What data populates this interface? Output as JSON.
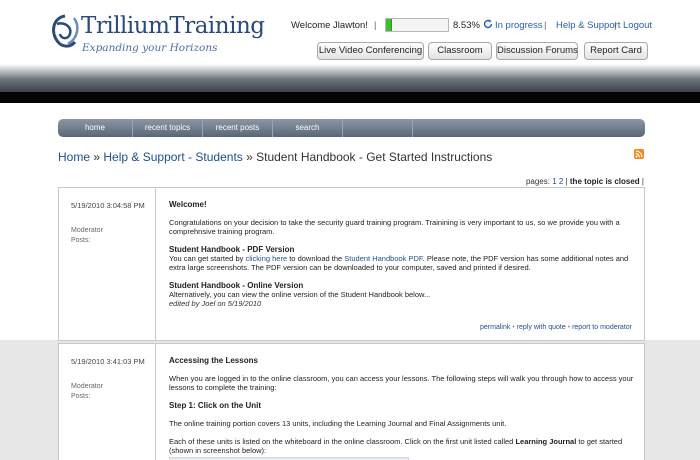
{
  "header": {
    "logo_title": "TrilliumTraining",
    "logo_tagline": "Expanding your Horizons",
    "welcome": "Welcome Jlawton!",
    "progress_percent": 8.53,
    "progress_text": "8.53%",
    "status": "In progress",
    "help_link": "Help & Support",
    "logout_link": "Logout",
    "buttons": [
      "Live Video Conferencing",
      "Classroom",
      "Discussion Forums",
      "Report Card"
    ]
  },
  "nav": {
    "items": [
      "home",
      "recent topics",
      "recent posts",
      "search"
    ]
  },
  "breadcrumb": {
    "home": "Home",
    "sep1": " » ",
    "section": "Help & Support - Students",
    "sep2": " » ",
    "current": "Student Handbook - Get Started Instructions"
  },
  "pagination": {
    "label": "pages:",
    "page1": "1",
    "page2": "2",
    "closed": "the topic is closed"
  },
  "posts": [
    {
      "date": "5/19/2010 3:04:58 PM",
      "role": "Moderator",
      "posts_label": "Posts:",
      "title": "Welcome!",
      "intro": "Congratulations on your decision to take the security guard training program. Trainining is very important to us, so we provide you with a comprehnsive training program.",
      "pdf_heading": "Student Handbook - PDF Version",
      "pdf_text_a": "You can get started by ",
      "pdf_link1": "clicking here",
      "pdf_text_b": " to download the ",
      "pdf_link2": "Student Handbook PDF",
      "pdf_text_c": ". Please note, the PDF version has some additional notes and extra large screenshots. The PDF version can be downloaded to your computer, saved and printed if desired.",
      "online_heading": "Student Handbook - Online Version",
      "online_text": "Alternatively, you can view the online version of the Student Handbook below...",
      "edited": "edited by Joel on 5/19/2010",
      "actions": [
        "permalink",
        "reply with quote",
        "report to moderator"
      ]
    },
    {
      "date": "5/19/2010 3:41:03 PM",
      "role": "Moderator",
      "posts_label": "Posts:",
      "title": "Accessing the Lessons",
      "intro": "When you are logged in to the online classroom, you can access your lessons. The following steps will walk you through how to access your lessons to complete the training:",
      "step_heading": "Step 1: Click on the Unit",
      "p1": "The online training portion covers 13 units, including the Learning Journal and Final Assignments unit.",
      "p2_a": "Each of these units is listed on the whiteboard in the online classroom. Click on the first unit listed called ",
      "p2_bold": "Learning Journal",
      "p2_b": " to get started (shown in screenshot below):"
    }
  ],
  "colors": {
    "link": "#1f4e8f",
    "progress": "#3bbf2e",
    "nav": "#5a6677",
    "rss": "#f08a24"
  }
}
